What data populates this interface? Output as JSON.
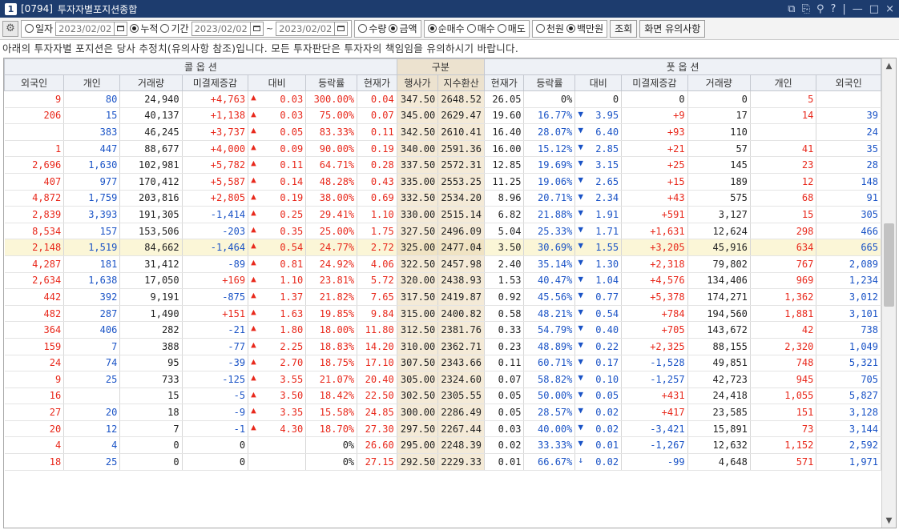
{
  "window": {
    "tab_number": "1",
    "screen_code": "[0794]",
    "title": "투자자별포지션종합",
    "controls": [
      "⧉",
      "⎘",
      "⚲",
      "?",
      "|",
      "—",
      "□",
      "×"
    ]
  },
  "toolbar": {
    "radio_day": "일자",
    "date_day": "2023/02/02",
    "radio_cumul": "누적",
    "radio_period": "기간",
    "date_from": "2023/02/02",
    "tilde": "~",
    "date_to": "2023/02/02",
    "radio_qty": "수량",
    "radio_amount": "금액",
    "radio_net": "순매수",
    "radio_buy": "매수",
    "radio_sell": "매도",
    "radio_thousand": "천원",
    "radio_million": "백만원",
    "query_button": "조회",
    "notes_button": "화면 유의사항",
    "selected": {
      "period": "누적",
      "unit_type": "금액",
      "trade": "순매수",
      "money_unit": "백만원"
    }
  },
  "notice": "아래의 투자자별 포지션은 당사 추정치(유의사항 참조)입니다. 모든 투자판단은 투자자의 책임임을 유의하시기 바랍니다.",
  "table": {
    "group_headers": {
      "call": "콜 옵 션",
      "center": "구분",
      "put": "풋 옵 션"
    },
    "columns": [
      "외국인",
      "개인",
      "거래량",
      "미결제증감",
      "대비",
      "등락률",
      "현재가",
      "행사가",
      "지수환산",
      "현재가",
      "등락률",
      "대비",
      "미결제증감",
      "거래량",
      "개인",
      "외국인"
    ],
    "rows": [
      {
        "c_for": "9",
        "c_ind": "80",
        "c_vol": "24,940",
        "c_oi": "+4,763",
        "c_chg": "0.03",
        "c_rate": "300.00%",
        "c_price": "0.04",
        "strike": "347.50",
        "idx": "2648.52",
        "p_price": "26.05",
        "p_rate": "0%",
        "p_arrow": "",
        "p_chg": "0",
        "p_oi": "0",
        "p_vol": "0",
        "p_ind": "5",
        "p_for": ""
      },
      {
        "c_for": "206",
        "c_ind": "15",
        "c_vol": "40,137",
        "c_oi": "+1,138",
        "c_chg": "0.03",
        "c_rate": "75.00%",
        "c_price": "0.07",
        "strike": "345.00",
        "idx": "2629.47",
        "p_price": "19.60",
        "p_rate": "16.77%",
        "p_arrow": "down",
        "p_chg": "3.95",
        "p_oi": "+9",
        "p_vol": "17",
        "p_ind": "14",
        "p_for": "39"
      },
      {
        "c_for": "",
        "c_ind": "383",
        "c_vol": "46,245",
        "c_oi": "+3,737",
        "c_chg": "0.05",
        "c_rate": "83.33%",
        "c_price": "0.11",
        "strike": "342.50",
        "idx": "2610.41",
        "p_price": "16.40",
        "p_rate": "28.07%",
        "p_arrow": "down",
        "p_chg": "6.40",
        "p_oi": "+93",
        "p_vol": "110",
        "p_ind": "",
        "p_for": "24"
      },
      {
        "c_for": "1",
        "c_ind": "447",
        "c_vol": "88,677",
        "c_oi": "+4,000",
        "c_chg": "0.09",
        "c_rate": "90.00%",
        "c_price": "0.19",
        "strike": "340.00",
        "idx": "2591.36",
        "p_price": "16.00",
        "p_rate": "15.12%",
        "p_arrow": "down",
        "p_chg": "2.85",
        "p_oi": "+21",
        "p_vol": "57",
        "p_ind": "41",
        "p_for": "35"
      },
      {
        "c_for": "2,696",
        "c_ind": "1,630",
        "c_vol": "102,981",
        "c_oi": "+5,782",
        "c_chg": "0.11",
        "c_rate": "64.71%",
        "c_price": "0.28",
        "strike": "337.50",
        "idx": "2572.31",
        "p_price": "12.85",
        "p_rate": "19.69%",
        "p_arrow": "down",
        "p_chg": "3.15",
        "p_oi": "+25",
        "p_vol": "145",
        "p_ind": "23",
        "p_for": "28"
      },
      {
        "c_for": "407",
        "c_ind": "977",
        "c_vol": "170,412",
        "c_oi": "+5,587",
        "c_chg": "0.14",
        "c_rate": "48.28%",
        "c_price": "0.43",
        "strike": "335.00",
        "idx": "2553.25",
        "p_price": "11.25",
        "p_rate": "19.06%",
        "p_arrow": "down",
        "p_chg": "2.65",
        "p_oi": "+15",
        "p_vol": "189",
        "p_ind": "12",
        "p_for": "148"
      },
      {
        "c_for": "4,872",
        "c_ind": "1,759",
        "c_vol": "203,816",
        "c_oi": "+2,805",
        "c_chg": "0.19",
        "c_rate": "38.00%",
        "c_price": "0.69",
        "strike": "332.50",
        "idx": "2534.20",
        "p_price": "8.96",
        "p_rate": "20.71%",
        "p_arrow": "down",
        "p_chg": "2.34",
        "p_oi": "+43",
        "p_vol": "575",
        "p_ind": "68",
        "p_for": "91"
      },
      {
        "c_for": "2,839",
        "c_ind": "3,393",
        "c_vol": "191,305",
        "c_oi": "-1,414",
        "c_chg": "0.25",
        "c_rate": "29.41%",
        "c_price": "1.10",
        "strike": "330.00",
        "idx": "2515.14",
        "p_price": "6.82",
        "p_rate": "21.88%",
        "p_arrow": "down",
        "p_chg": "1.91",
        "p_oi": "+591",
        "p_vol": "3,127",
        "p_ind": "15",
        "p_for": "305"
      },
      {
        "c_for": "8,534",
        "c_ind": "157",
        "c_vol": "153,506",
        "c_oi": "-203",
        "c_chg": "0.35",
        "c_rate": "25.00%",
        "c_price": "1.75",
        "strike": "327.50",
        "idx": "2496.09",
        "p_price": "5.04",
        "p_rate": "25.33%",
        "p_arrow": "down",
        "p_chg": "1.71",
        "p_oi": "+1,631",
        "p_vol": "12,624",
        "p_ind": "298",
        "p_for": "466"
      },
      {
        "c_for": "2,148",
        "c_ind": "1,519",
        "c_vol": "84,662",
        "c_oi": "-1,464",
        "c_chg": "0.54",
        "c_rate": "24.77%",
        "c_price": "2.72",
        "strike": "325.00",
        "idx": "2477.04",
        "p_price": "3.50",
        "p_rate": "30.69%",
        "p_arrow": "down",
        "p_chg": "1.55",
        "p_oi": "+3,205",
        "p_vol": "45,916",
        "p_ind": "634",
        "p_for": "665",
        "highlight": true
      },
      {
        "c_for": "4,287",
        "c_ind": "181",
        "c_vol": "31,412",
        "c_oi": "-89",
        "c_chg": "0.81",
        "c_rate": "24.92%",
        "c_price": "4.06",
        "strike": "322.50",
        "idx": "2457.98",
        "p_price": "2.40",
        "p_rate": "35.14%",
        "p_arrow": "down",
        "p_chg": "1.30",
        "p_oi": "+2,318",
        "p_vol": "79,802",
        "p_ind": "767",
        "p_for": "2,089"
      },
      {
        "c_for": "2,634",
        "c_ind": "1,638",
        "c_vol": "17,050",
        "c_oi": "+169",
        "c_chg": "1.10",
        "c_rate": "23.81%",
        "c_price": "5.72",
        "strike": "320.00",
        "idx": "2438.93",
        "p_price": "1.53",
        "p_rate": "40.47%",
        "p_arrow": "down",
        "p_chg": "1.04",
        "p_oi": "+4,576",
        "p_vol": "134,406",
        "p_ind": "969",
        "p_for": "1,234"
      },
      {
        "c_for": "442",
        "c_ind": "392",
        "c_vol": "9,191",
        "c_oi": "-875",
        "c_chg": "1.37",
        "c_rate": "21.82%",
        "c_price": "7.65",
        "strike": "317.50",
        "idx": "2419.87",
        "p_price": "0.92",
        "p_rate": "45.56%",
        "p_arrow": "down",
        "p_chg": "0.77",
        "p_oi": "+5,378",
        "p_vol": "174,271",
        "p_ind": "1,362",
        "p_for": "3,012"
      },
      {
        "c_for": "482",
        "c_ind": "287",
        "c_vol": "1,490",
        "c_oi": "+151",
        "c_chg": "1.63",
        "c_rate": "19.85%",
        "c_price": "9.84",
        "strike": "315.00",
        "idx": "2400.82",
        "p_price": "0.58",
        "p_rate": "48.21%",
        "p_arrow": "down",
        "p_chg": "0.54",
        "p_oi": "+784",
        "p_vol": "194,560",
        "p_ind": "1,881",
        "p_for": "3,101"
      },
      {
        "c_for": "364",
        "c_ind": "406",
        "c_vol": "282",
        "c_oi": "-21",
        "c_chg": "1.80",
        "c_rate": "18.00%",
        "c_price": "11.80",
        "strike": "312.50",
        "idx": "2381.76",
        "p_price": "0.33",
        "p_rate": "54.79%",
        "p_arrow": "down",
        "p_chg": "0.40",
        "p_oi": "+705",
        "p_vol": "143,672",
        "p_ind": "42",
        "p_for": "738"
      },
      {
        "c_for": "159",
        "c_ind": "7",
        "c_vol": "388",
        "c_oi": "-77",
        "c_chg": "2.25",
        "c_rate": "18.83%",
        "c_price": "14.20",
        "strike": "310.00",
        "idx": "2362.71",
        "p_price": "0.23",
        "p_rate": "48.89%",
        "p_arrow": "down",
        "p_chg": "0.22",
        "p_oi": "+2,325",
        "p_vol": "88,155",
        "p_ind": "2,320",
        "p_for": "1,049"
      },
      {
        "c_for": "24",
        "c_ind": "74",
        "c_vol": "95",
        "c_oi": "-39",
        "c_chg": "2.70",
        "c_rate": "18.75%",
        "c_price": "17.10",
        "strike": "307.50",
        "idx": "2343.66",
        "p_price": "0.11",
        "p_rate": "60.71%",
        "p_arrow": "down",
        "p_chg": "0.17",
        "p_oi": "-1,528",
        "p_vol": "49,851",
        "p_ind": "748",
        "p_for": "5,321"
      },
      {
        "c_for": "9",
        "c_ind": "25",
        "c_vol": "733",
        "c_oi": "-125",
        "c_chg": "3.55",
        "c_rate": "21.07%",
        "c_price": "20.40",
        "strike": "305.00",
        "idx": "2324.60",
        "p_price": "0.07",
        "p_rate": "58.82%",
        "p_arrow": "down",
        "p_chg": "0.10",
        "p_oi": "-1,257",
        "p_vol": "42,723",
        "p_ind": "945",
        "p_for": "705"
      },
      {
        "c_for": "16",
        "c_ind": "",
        "c_vol": "15",
        "c_oi": "-5",
        "c_chg": "3.50",
        "c_rate": "18.42%",
        "c_price": "22.50",
        "strike": "302.50",
        "idx": "2305.55",
        "p_price": "0.05",
        "p_rate": "50.00%",
        "p_arrow": "down",
        "p_chg": "0.05",
        "p_oi": "+431",
        "p_vol": "24,418",
        "p_ind": "1,055",
        "p_for": "5,827"
      },
      {
        "c_for": "27",
        "c_ind": "20",
        "c_vol": "18",
        "c_oi": "-9",
        "c_chg": "3.35",
        "c_rate": "15.58%",
        "c_price": "24.85",
        "strike": "300.00",
        "idx": "2286.49",
        "p_price": "0.05",
        "p_rate": "28.57%",
        "p_arrow": "down",
        "p_chg": "0.02",
        "p_oi": "+417",
        "p_vol": "23,585",
        "p_ind": "151",
        "p_for": "3,128"
      },
      {
        "c_for": "20",
        "c_ind": "12",
        "c_vol": "7",
        "c_oi": "-1",
        "c_chg": "4.30",
        "c_rate": "18.70%",
        "c_price": "27.30",
        "strike": "297.50",
        "idx": "2267.44",
        "p_price": "0.03",
        "p_rate": "40.00%",
        "p_arrow": "down",
        "p_chg": "0.02",
        "p_oi": "-3,421",
        "p_vol": "15,891",
        "p_ind": "73",
        "p_for": "3,144"
      },
      {
        "c_for": "4",
        "c_ind": "4",
        "c_vol": "0",
        "c_oi": "0",
        "c_chg": "",
        "c_rate": "0%",
        "c_price": "26.60",
        "strike": "295.00",
        "idx": "2248.39",
        "p_price": "0.02",
        "p_rate": "33.33%",
        "p_arrow": "down",
        "p_chg": "0.01",
        "p_oi": "-1,267",
        "p_vol": "12,632",
        "p_ind": "1,152",
        "p_for": "2,592"
      },
      {
        "c_for": "18",
        "c_ind": "25",
        "c_vol": "0",
        "c_oi": "0",
        "c_chg": "",
        "c_rate": "0%",
        "c_price": "27.15",
        "strike": "292.50",
        "idx": "2229.33",
        "p_price": "0.01",
        "p_rate": "66.67%",
        "p_arrow": "lower",
        "p_chg": "0.02",
        "p_oi": "-99",
        "p_vol": "4,648",
        "p_ind": "571",
        "p_for": "1,971"
      }
    ]
  },
  "colors": {
    "title_bg": "#1d3c6e",
    "up": "#e8281b",
    "down": "#1a53c6",
    "center_col": "#f4ead7",
    "highlight_row": "#fbf6d7"
  },
  "icons": {
    "gear": "gear-icon",
    "calendar": "calendar-icon",
    "arrow_up": "triangle-up",
    "arrow_down": "triangle-down",
    "lower_limit": "down-arrow"
  }
}
